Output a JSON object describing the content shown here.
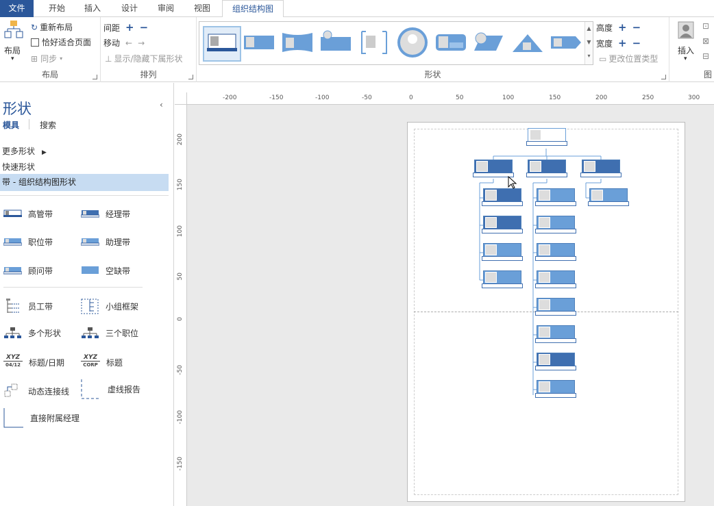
{
  "tabs": [
    {
      "label": "文件"
    },
    {
      "label": "开始"
    },
    {
      "label": "插入"
    },
    {
      "label": "设计"
    },
    {
      "label": "审阅"
    },
    {
      "label": "视图"
    },
    {
      "label": "组织结构图"
    }
  ],
  "ribbon": {
    "layout": {
      "layout_btn": "布局",
      "relayout": "重新布局",
      "best_fit": "恰好适合页面",
      "sync": "同步",
      "label": "布局"
    },
    "arrange": {
      "spacing": "间距",
      "move": "移动",
      "show_hide": "显示/隐藏下属形状",
      "label": "排列"
    },
    "shapes": {
      "label": "形状"
    },
    "size": {
      "height": "高度",
      "width": "宽度",
      "change_pos": "更改位置类型"
    },
    "insert": {
      "label": "插入",
      "group_cut": "图"
    }
  },
  "left_pane": {
    "title": "形状",
    "tab_stencil": "模具",
    "tab_search": "搜索",
    "more_shapes": "更多形状",
    "quick_shapes": "快速形状",
    "selected_stencil": "带 - 组织结构图形状",
    "items": [
      {
        "label": "高管带",
        "icon": "executive-band-icon"
      },
      {
        "label": "经理带",
        "icon": "manager-band-icon"
      },
      {
        "label": "职位带",
        "icon": "position-band-icon"
      },
      {
        "label": "助理带",
        "icon": "assistant-band-icon"
      },
      {
        "label": "顾问带",
        "icon": "consultant-band-icon"
      },
      {
        "label": "空缺带",
        "icon": "vacancy-band-icon"
      },
      {
        "label": "员工带",
        "icon": "staff-band-icon"
      },
      {
        "label": "小组框架",
        "icon": "team-frame-icon"
      },
      {
        "label": "多个形状",
        "icon": "multiple-shapes-icon"
      },
      {
        "label": "三个职位",
        "icon": "three-positions-icon"
      },
      {
        "label": "标题/日期",
        "icon": "title-date-icon"
      },
      {
        "label": "标题",
        "icon": "title-icon"
      },
      {
        "label": "动态连接线",
        "icon": "dynamic-connector-icon"
      },
      {
        "label": "虚线报告",
        "icon": "dotted-line-report-icon"
      },
      {
        "label": "直接附属经理",
        "icon": "direct-report-manager-icon"
      }
    ],
    "icon_text": {
      "xyz": "XYZ",
      "date": "04/12",
      "corp": "CORP"
    }
  },
  "ruler_h": [
    "-200",
    "-150",
    "-100",
    "-50",
    "0",
    "50",
    "100",
    "150",
    "200",
    "250",
    "300"
  ],
  "ruler_v": [
    "200",
    "150",
    "100",
    "50",
    "0",
    "-50",
    "-100",
    "-150"
  ],
  "colors": {
    "accent": "#2b579a",
    "shape_fill": "#6a9fd8",
    "shape_dark": "#3f6fb0",
    "selected_bg": "#c7dcf2"
  }
}
